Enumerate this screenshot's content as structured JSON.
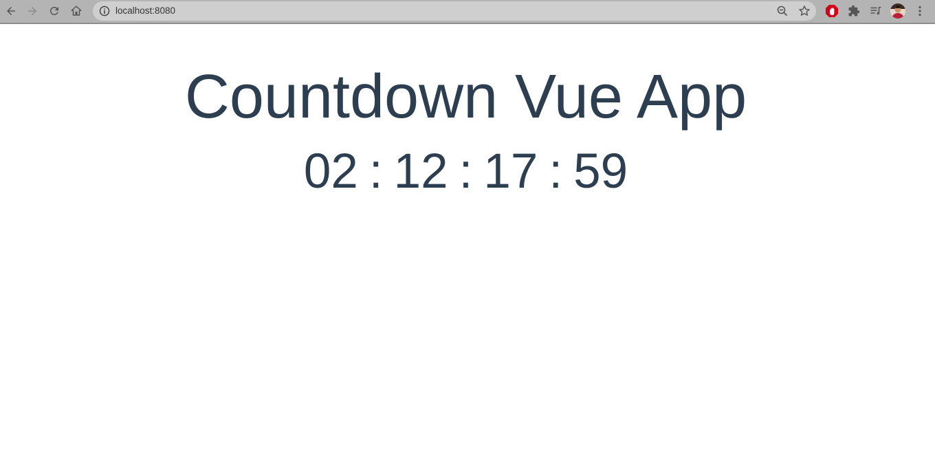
{
  "browser": {
    "url": "localhost:8080",
    "icons": {
      "back": "back-arrow-icon",
      "forward": "forward-arrow-icon",
      "reload": "reload-icon",
      "home": "home-icon",
      "site_info": "info-icon",
      "zoom": "zoom-out-icon",
      "bookmark": "star-icon",
      "adblock": "stop-hand-icon",
      "extensions": "puzzle-icon",
      "media": "media-playlist-icon",
      "menu": "kebab-menu-icon"
    },
    "colors": {
      "toolbar": "#b4b4b4",
      "omnibox": "#cfcfcf",
      "adblock": "#d4001a"
    }
  },
  "app": {
    "title": "Countdown Vue App",
    "countdown": {
      "days": "02",
      "hours": "12",
      "minutes": "17",
      "seconds": "59",
      "separator": ":"
    },
    "text_color": "#2c3e50"
  }
}
